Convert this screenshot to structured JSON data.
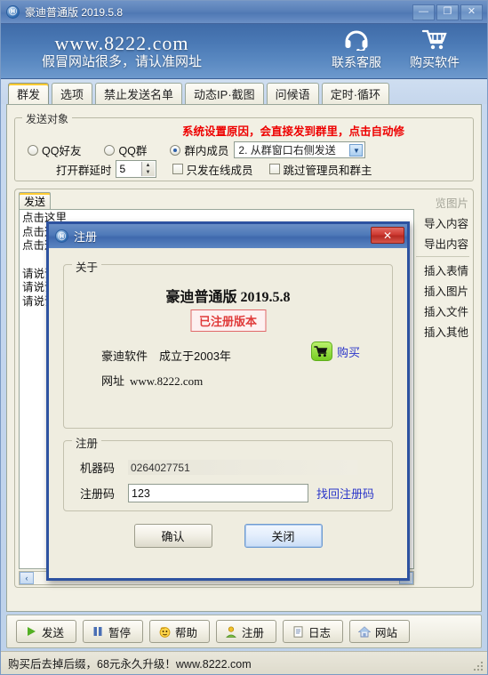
{
  "window": {
    "title": "豪迪普通版 2019.5.8",
    "icon": "app-icon",
    "controls": [
      {
        "name": "minimize",
        "glyph": "—"
      },
      {
        "name": "maximize",
        "glyph": "❐"
      },
      {
        "name": "close",
        "glyph": "✕"
      }
    ]
  },
  "banner": {
    "url": "www.8222.com",
    "subtitle": "假冒网站很多，请认准网址",
    "actions": [
      {
        "icon": "headset-icon",
        "label": "联系客服"
      },
      {
        "icon": "cart-icon",
        "label": "购买软件"
      }
    ]
  },
  "tabs": [
    {
      "label": "群发",
      "active": true
    },
    {
      "label": "选项",
      "active": false
    },
    {
      "label": "禁止发送名单",
      "active": false
    },
    {
      "label": "动态IP·截图",
      "active": false
    },
    {
      "label": "问候语",
      "active": false
    },
    {
      "label": "定时·循环",
      "active": false
    }
  ],
  "target_group": {
    "title": "发送对象",
    "warning": "系统设置原因，会直接发到群里，点击自动修",
    "radios": [
      {
        "label": "QQ好友",
        "checked": false
      },
      {
        "label": "QQ群",
        "checked": false
      },
      {
        "label": "群内成员",
        "checked": true
      }
    ],
    "send_mode_select": {
      "value": "2. 从群窗口右侧发送",
      "arrow": "chevron-down-icon"
    },
    "delay_label": "打开群延时",
    "delay_value": "5",
    "checkboxes": [
      {
        "label": "只发在线成员",
        "checked": false
      },
      {
        "label": "跳过管理员和群主",
        "checked": false
      }
    ]
  },
  "editor": {
    "tab_label": "发送",
    "lines": [
      "点击这里",
      "点击这里",
      "点击这里",
      "",
      "请说话",
      "请说话",
      "请说话"
    ],
    "scroll_left": "‹",
    "scroll_right": "›",
    "side_buttons": [
      {
        "label": "览图片",
        "disabled": true
      },
      {
        "label": "导入内容",
        "disabled": false
      },
      {
        "label": "导出内容",
        "disabled": false
      },
      {
        "separator": true
      },
      {
        "label": "插入表情",
        "disabled": false
      },
      {
        "label": "插入图片",
        "disabled": false
      },
      {
        "label": "插入文件",
        "disabled": false
      },
      {
        "label": "插入其他",
        "disabled": false
      }
    ]
  },
  "toolbar": [
    {
      "icon": "play-icon",
      "label": "发送"
    },
    {
      "icon": "pause-icon",
      "label": "暂停"
    },
    {
      "icon": "help-face-icon",
      "label": "帮助"
    },
    {
      "icon": "user-icon",
      "label": "注册"
    },
    {
      "icon": "log-icon",
      "label": "日志"
    },
    {
      "icon": "home-icon",
      "label": "网站"
    }
  ],
  "statusbar": {
    "text": "购买后去掉后缀，68元永久升级！www.8222.com",
    "grip": "resize-grip"
  },
  "dialog": {
    "title": "注册",
    "icon": "app-icon",
    "close_glyph": "✕",
    "about": {
      "legend": "关于",
      "version": "豪迪普通版 2019.5.8",
      "status": "已注册版本",
      "company": "豪迪软件　成立于2003年",
      "site_label": "网址",
      "site_value": "www.8222.com",
      "buy": {
        "icon": "cart-icon",
        "label": "购买"
      }
    },
    "register": {
      "legend": "注册",
      "machine_label": "机器码",
      "machine_value": "0264027751",
      "code_label": "注册码",
      "code_value": "123",
      "recover_link": "找回注册码"
    },
    "buttons": [
      {
        "label": "确认",
        "focused": false
      },
      {
        "label": "关闭",
        "focused": true
      }
    ]
  },
  "colors": {
    "accent_blue": "#2d52a0",
    "title_blue": "#4e79b8",
    "warning_red": "#ee0000",
    "registered_red": "#e03b3b",
    "link_blue": "#2b36c9",
    "dialog_bg": "#efede0",
    "content_bg": "#f2f0e4",
    "close_red": "#cf3b33",
    "cart_green": "#76cc23"
  }
}
